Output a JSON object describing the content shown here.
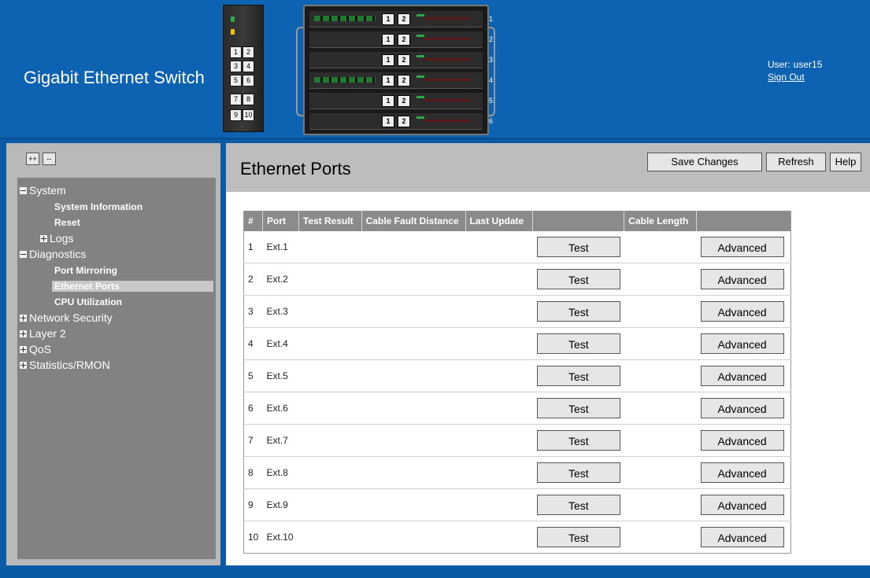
{
  "header": {
    "title": "Gigabit Ethernet Switch",
    "user_label": "User:",
    "user_name": "user15",
    "sign_out": "Sign Out",
    "switch_module_ports": [
      "1",
      "2",
      "3",
      "4",
      "5",
      "6",
      "7",
      "8",
      "9",
      "10"
    ],
    "chassis_bays": [
      {
        "num": "1",
        "port_a": "1",
        "port_b": "2"
      },
      {
        "num": "2",
        "port_a": "1",
        "port_b": "2"
      },
      {
        "num": "3",
        "port_a": "1",
        "port_b": "2"
      },
      {
        "num": "4",
        "port_a": "1",
        "port_b": "2"
      },
      {
        "num": "5",
        "port_a": "1",
        "port_b": "2"
      },
      {
        "num": "6",
        "port_a": "1",
        "port_b": "2"
      }
    ]
  },
  "nav": {
    "expand_all": "++",
    "collapse_all": "--",
    "items": [
      {
        "label": "System",
        "expander": "minus"
      },
      {
        "label": "System Information"
      },
      {
        "label": "Reset"
      },
      {
        "label": "Logs",
        "expander": "plus"
      },
      {
        "label": "Diagnostics",
        "expander": "minus"
      },
      {
        "label": "Port Mirroring"
      },
      {
        "label": "Ethernet Ports",
        "selected": true
      },
      {
        "label": "CPU Utilization"
      },
      {
        "label": "Network Security",
        "expander": "plus"
      },
      {
        "label": "Layer 2",
        "expander": "plus"
      },
      {
        "label": "QoS",
        "expander": "plus"
      },
      {
        "label": "Statistics/RMON",
        "expander": "plus"
      }
    ]
  },
  "main": {
    "title": "Ethernet Ports",
    "buttons": {
      "save": "Save Changes",
      "refresh": "Refresh",
      "help": "Help"
    },
    "table": {
      "columns": [
        "#",
        "Port",
        "Test Result",
        "Cable Fault Distance",
        "Last Update",
        "",
        "Cable Length",
        ""
      ],
      "test_label": "Test",
      "advanced_label": "Advanced",
      "rows": [
        {
          "num": "1",
          "port": "Ext.1"
        },
        {
          "num": "2",
          "port": "Ext.2"
        },
        {
          "num": "3",
          "port": "Ext.3"
        },
        {
          "num": "4",
          "port": "Ext.4"
        },
        {
          "num": "5",
          "port": "Ext.5"
        },
        {
          "num": "6",
          "port": "Ext.6"
        },
        {
          "num": "7",
          "port": "Ext.7"
        },
        {
          "num": "8",
          "port": "Ext.8"
        },
        {
          "num": "9",
          "port": "Ext.9"
        },
        {
          "num": "10",
          "port": "Ext.10"
        }
      ]
    }
  },
  "colors": {
    "header_bg": "#0d62b2",
    "nav_tree_bg": "#828282",
    "table_header_bg": "#8b8b8b",
    "led_green": "#2fa84a",
    "led_yellow": "#f2c200"
  }
}
